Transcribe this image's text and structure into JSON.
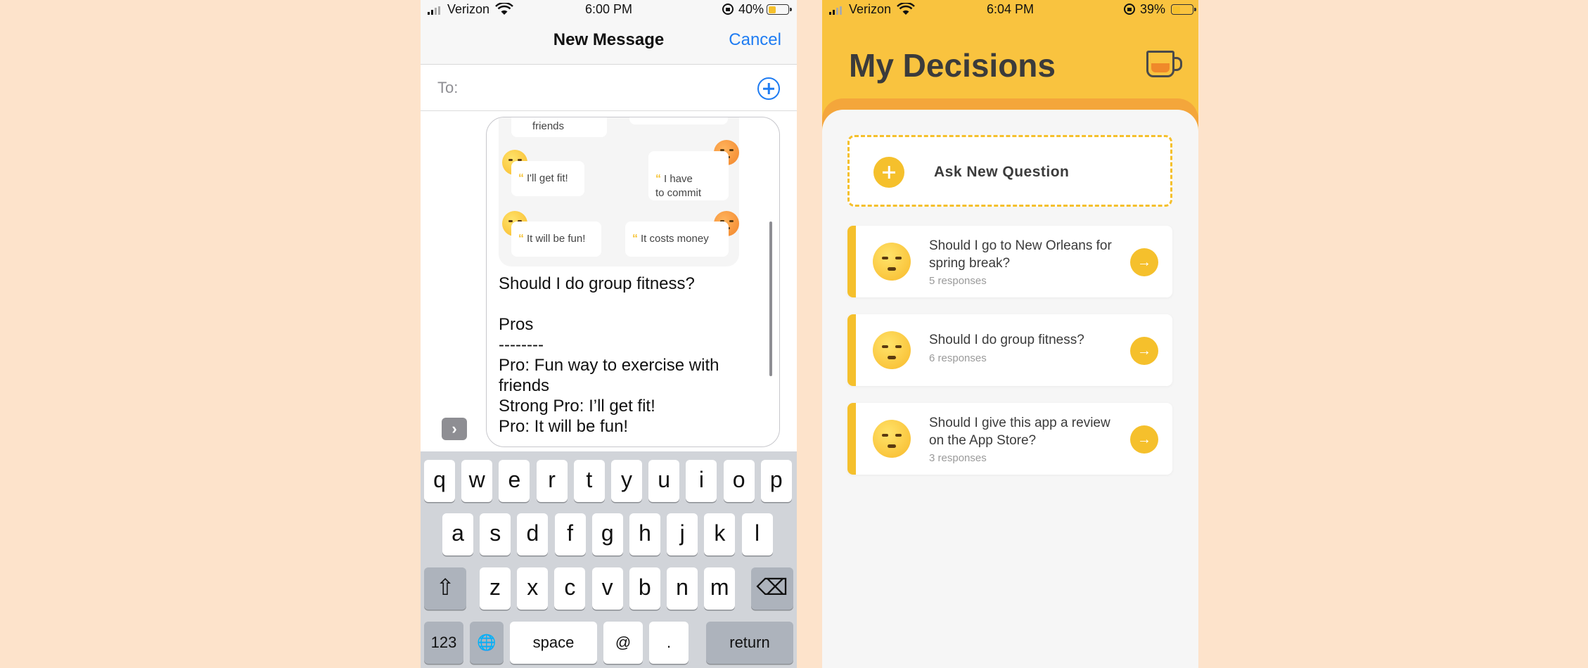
{
  "left_phone": {
    "status": {
      "carrier": "Verizon",
      "time": "6:00 PM",
      "battery": "40%",
      "battery_level": 0.4
    },
    "nav": {
      "title": "New Message",
      "cancel": "Cancel"
    },
    "to_label": "To:",
    "preview": {
      "card_friends": "friends",
      "card_fit": "I'll get fit!",
      "card_commit": "I have\nto commit",
      "card_fun": "It will be fun!",
      "card_money": "It costs money",
      "quote_mark": "“"
    },
    "message": "Should I do group fitness?\n\nPros\n--------\nPro: Fun way to exercise with friends\nStrong Pro: I’ll get fit!\nPro: It will be fun!",
    "chevron": "›",
    "keyboard": {
      "row1": [
        "q",
        "w",
        "e",
        "r",
        "t",
        "y",
        "u",
        "i",
        "o",
        "p"
      ],
      "row2": [
        "a",
        "s",
        "d",
        "f",
        "g",
        "h",
        "j",
        "k",
        "l"
      ],
      "row3": [
        "z",
        "x",
        "c",
        "v",
        "b",
        "n",
        "m"
      ],
      "numbers": "123",
      "space": "space",
      "at": "@",
      "period": ".",
      "return": "return",
      "shift_icon": "⇧",
      "backspace_icon": "⌫",
      "globe_icon": "🌐"
    }
  },
  "right_phone": {
    "status": {
      "carrier": "Verizon",
      "time": "6:04 PM",
      "battery": "39%",
      "battery_level": 0.39
    },
    "title": "My Decisions",
    "ask_label": "Ask New Question",
    "questions": [
      {
        "text": "Should I go to New Orleans for spring break?",
        "responses": "5 responses"
      },
      {
        "text": "Should I do group fitness?",
        "responses": "6 responses"
      },
      {
        "text": "Should I give this app a review on the App Store?",
        "responses": "3 responses"
      }
    ],
    "arrow": "→"
  },
  "colors": {
    "background": "#fde3cb",
    "ios_blue": "#1f7cf2",
    "accent_yellow": "#f5c02c",
    "header_yellow": "#f9c33f",
    "band_orange": "#f4a63b"
  }
}
